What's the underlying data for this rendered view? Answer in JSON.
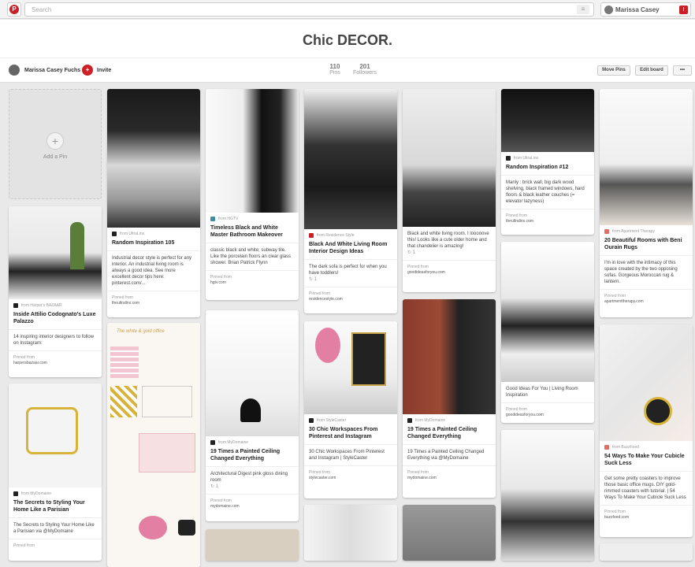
{
  "topbar": {
    "search_placeholder": "Search",
    "logo_letter": "P",
    "user_name": "Marissa Casey",
    "notif": "!"
  },
  "board": {
    "title": "Chic DECOR.",
    "owner": "Marissa Casey Fuchs",
    "invite": "Invite",
    "pins_count": "110",
    "pins_label": "Pins",
    "followers_count": "201",
    "followers_label": "Followers",
    "move_pins": "Move Pins",
    "edit_board": "Edit board",
    "more": "•••"
  },
  "add_pin": {
    "plus": "+",
    "label": "Add a Pin"
  },
  "pins": [
    {
      "src": "from Harper's BAZAAR",
      "title": "Inside Attilio Codognato's Luxe Palazzo",
      "desc": "14 inspiring interior designers to follow on Instagram:",
      "foot_label": "Pinned from",
      "foot_site": "harpersbazaar.com"
    },
    {
      "src": "from MyDomaine",
      "title": "The Secrets to Styling Your Home Like a Parisian",
      "desc": "The Secrets to Styling Your Home Like a Parisian via @MyDomaine",
      "foot_label": "Pinned from",
      "foot_site": ""
    },
    {
      "src": "from UltraLinx",
      "title": "Random Inspiration 105",
      "desc": "Industrial decor style is perfect for any interior. An industrial living room is always a good idea. See more excellent decor tips here: pinterest.com/...",
      "foot_label": "Pinned from",
      "foot_site": "theultralinx.com"
    },
    {
      "src": "from HGTV",
      "title": "Timeless Black and White Master Bathroom Makeover",
      "desc": "classic black and white; subway tile. Like the porcelain floors an clear glass shower. Brian Patrick Flynn",
      "foot_label": "Pinned from",
      "foot_site": "hgtv.com"
    },
    {
      "src": "from MyDomaine",
      "title": "19 Times a Painted Ceiling Changed Everything",
      "desc": "Architectural Digest pink gloss dining room",
      "repins": "↻ 1",
      "foot_label": "Pinned from",
      "foot_site": "mydomaine.com"
    },
    {
      "src": "from Residence Style",
      "title": "Black And White Living Room Interior Design Ideas",
      "desc": "The dark sofa is perfect for when you have toddlers!",
      "repins": "↻ 1",
      "foot_label": "Pinned from",
      "foot_site": "residencestyle.com"
    },
    {
      "src": "from StyleCaster",
      "title": "30 Chic Workspaces From Pinterest and Instagram",
      "desc": "30 Chic Workspaces From Pinterest and Instagram | StyleCaster",
      "foot_label": "Pinned from",
      "foot_site": "stylecaster.com"
    },
    {
      "desc": "Black and white living room. I looooove this! Looks like a cute older home and that chandelier is amazing!",
      "repins": "↻ 1",
      "foot_label": "Pinned from",
      "foot_site": "goodideasforyou.com"
    },
    {
      "src": "from MyDomaine",
      "title": "19 Times a Painted Ceiling Changed Everything",
      "desc": "19 Times a Painted Ceiling Changed Everything via @MyDomaine",
      "foot_label": "Pinned from",
      "foot_site": "mydomaine.com"
    },
    {
      "src": "from UltraLinx",
      "title": "Random Inspiration #12",
      "desc": "Manly : brick wall, big dark wood shelving, black framed windows, hard floors & black leather couches (= elevator lazyness)",
      "foot_label": "Pinned from",
      "foot_site": "theultralinx.com"
    },
    {
      "desc": "Good Ideas For You | Living Room Inspiration",
      "foot_label": "Pinned from",
      "foot_site": "goodideasforyou.com"
    },
    {
      "src": "from Apartment Therapy",
      "title": "20 Beautiful Rooms with Beni Ourain Rugs",
      "desc": "I'm in love with the intimacy of this space created by the two opposing sofas. Gorgeous Moroccan rug & lantern.",
      "foot_label": "Pinned from",
      "foot_site": "apartmenttherapy.com"
    },
    {
      "src": "from BuzzFeed",
      "title": "54 Ways To Make Your Cubicle Suck Less",
      "desc": "Get some pretty coasters to improve those basic office mugs. DIY gold-rimmed coasters with tutorial. | 54 Ways To Make Your Cubicle Suck Less",
      "foot_label": "Pinned from",
      "foot_site": "buzzfeed.com"
    }
  ],
  "image_text": {
    "white_gold_office": "The white & gold office"
  }
}
